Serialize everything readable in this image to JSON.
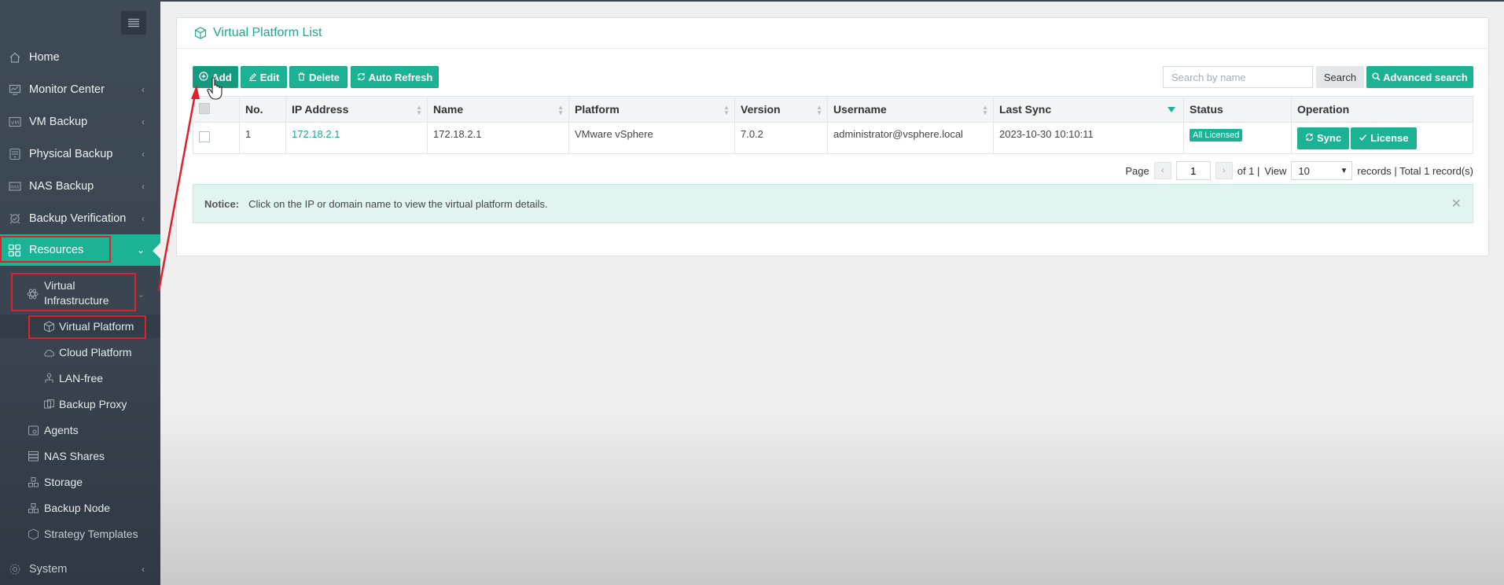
{
  "sidebar": {
    "items": [
      {
        "label": "Home",
        "icon": "home-icon"
      },
      {
        "label": "Monitor Center",
        "icon": "monitor-icon"
      },
      {
        "label": "VM Backup",
        "icon": "vm-icon"
      },
      {
        "label": "Physical Backup",
        "icon": "server-icon"
      },
      {
        "label": "NAS Backup",
        "icon": "nas-icon"
      },
      {
        "label": "Backup Verification",
        "icon": "verify-icon"
      },
      {
        "label": "Resources",
        "icon": "grid-icon"
      }
    ],
    "virtual_infrastructure": "Virtual Infrastructure",
    "virtual_infrastructure_line1": "Virtual",
    "virtual_infrastructure_line2": "Infrastructure",
    "sub_items": [
      {
        "label": "Virtual Platform",
        "icon": "cube-icon"
      },
      {
        "label": "Cloud Platform",
        "icon": "cloud-icon"
      },
      {
        "label": "LAN-free",
        "icon": "lan-icon"
      },
      {
        "label": "Backup Proxy",
        "icon": "proxy-icon"
      }
    ],
    "resource_items": [
      {
        "label": "Agents",
        "icon": "agent-icon"
      },
      {
        "label": "NAS Shares",
        "icon": "share-icon"
      },
      {
        "label": "Storage",
        "icon": "storage-icon"
      },
      {
        "label": "Backup Node",
        "icon": "node-icon"
      },
      {
        "label": "Strategy Templates",
        "icon": "template-icon"
      }
    ],
    "system": "System"
  },
  "panel": {
    "title": "Virtual Platform List"
  },
  "toolbar": {
    "add": "Add",
    "edit": "Edit",
    "delete": "Delete",
    "auto_refresh": "Auto Refresh",
    "search_placeholder": "Search by name",
    "search": "Search",
    "advanced_search": "Advanced search"
  },
  "table": {
    "columns": [
      "No.",
      "IP Address",
      "Name",
      "Platform",
      "Version",
      "Username",
      "Last Sync",
      "Status",
      "Operation"
    ],
    "rows": [
      {
        "no": "1",
        "ip": "172.18.2.1",
        "name": "172.18.2.1",
        "platform": "VMware vSphere",
        "version": "7.0.2",
        "username": "administrator@vsphere.local",
        "last_sync": "2023-10-30 10:10:11",
        "status": "All Licensed",
        "op_sync": "Sync",
        "op_license": "License"
      }
    ]
  },
  "pagination": {
    "page_label": "Page",
    "page": "1",
    "of": "of 1 |",
    "view_label": "View",
    "view": "10",
    "records": "records | Total 1 record(s)"
  },
  "notice": {
    "label": "Notice:",
    "text": "Click on the IP or domain name to view the virtual platform details."
  },
  "colors": {
    "accent": "#1bb394",
    "sidebar": "#3f4a57",
    "annotation": "#e0202a"
  }
}
